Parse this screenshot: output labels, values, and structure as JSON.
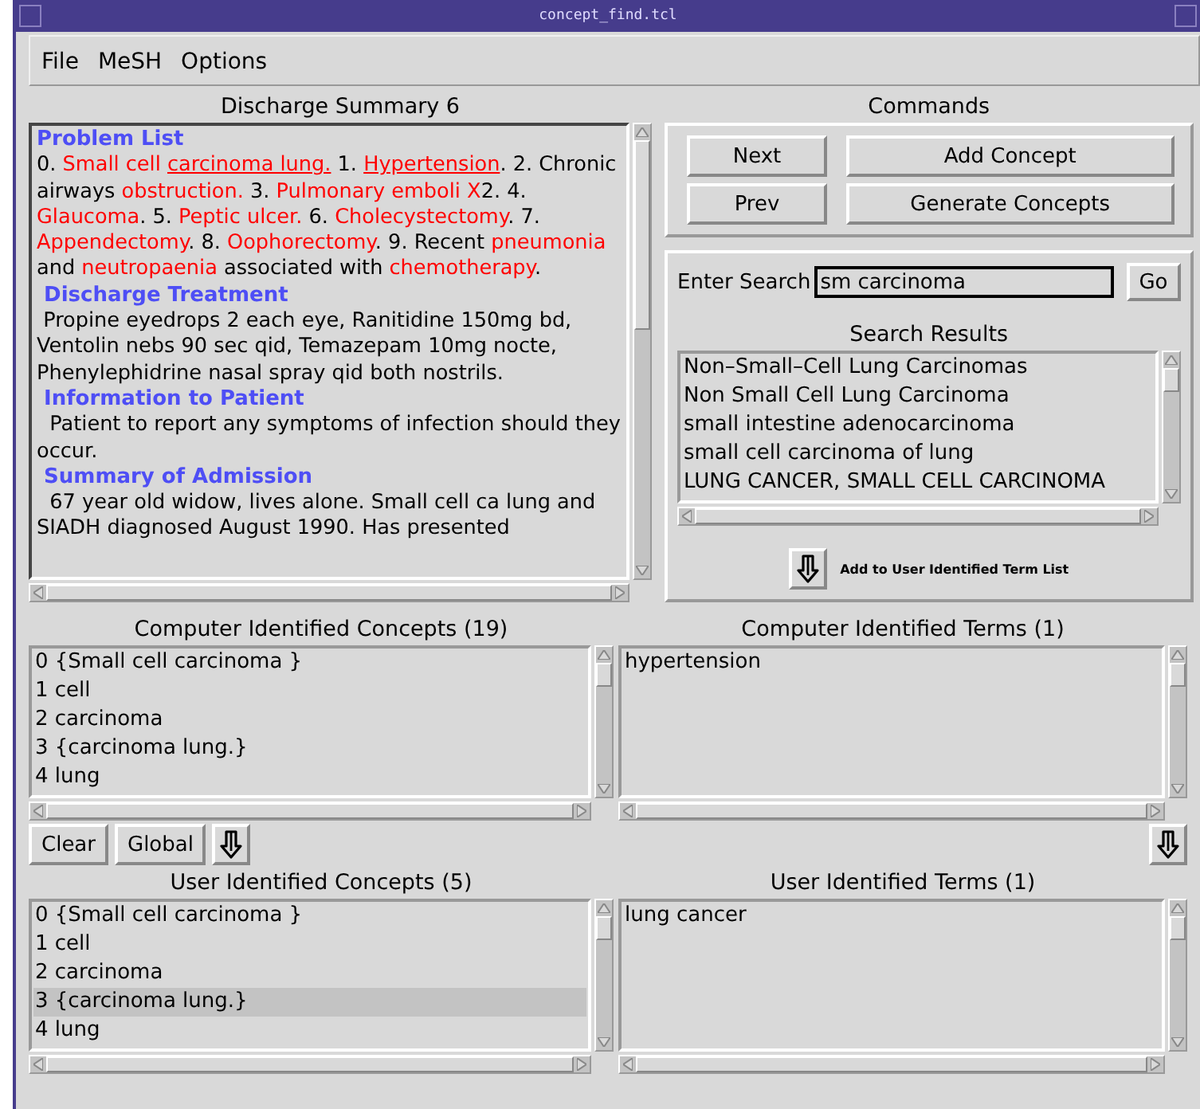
{
  "window": {
    "title": "concept_find.tcl"
  },
  "menu": [
    "File",
    "MeSH",
    "Options"
  ],
  "document": {
    "title": "Discharge Summary 6",
    "sections": [
      {
        "heading": "Problem List",
        "segments": [
          {
            "text": "0. ",
            "kind": "plain"
          },
          {
            "text": "Small cell ",
            "kind": "term"
          },
          {
            "text": "carcinoma lung.",
            "kind": "match"
          },
          {
            "text": " 1. ",
            "kind": "plain"
          },
          {
            "text": "Hypertension",
            "kind": "match"
          },
          {
            "text": ". 2. Chronic airways ",
            "kind": "plain"
          },
          {
            "text": "obstruction.",
            "kind": "term"
          },
          {
            "text": " 3. ",
            "kind": "plain"
          },
          {
            "text": "Pulmonary emboli X",
            "kind": "term"
          },
          {
            "text": "2. 4. ",
            "kind": "plain"
          },
          {
            "text": "Glaucoma",
            "kind": "term"
          },
          {
            "text": ". 5. ",
            "kind": "plain"
          },
          {
            "text": "Peptic ulcer.",
            "kind": "term"
          },
          {
            "text": " 6. ",
            "kind": "plain"
          },
          {
            "text": "Cholecystectomy",
            "kind": "term"
          },
          {
            "text": ". 7. ",
            "kind": "plain"
          },
          {
            "text": "Appendectomy",
            "kind": "term"
          },
          {
            "text": ". 8. ",
            "kind": "plain"
          },
          {
            "text": "Oophorectomy",
            "kind": "term"
          },
          {
            "text": ". 9. Recent ",
            "kind": "plain"
          },
          {
            "text": "pneumonia",
            "kind": "term"
          },
          {
            "text": " and ",
            "kind": "plain"
          },
          {
            "text": "neutropaenia",
            "kind": "term"
          },
          {
            "text": " associated with ",
            "kind": "plain"
          },
          {
            "text": "chemotherapy",
            "kind": "term"
          },
          {
            "text": ".",
            "kind": "plain"
          }
        ]
      },
      {
        "heading": " Discharge Treatment",
        "segments": [
          {
            "text": " Propine eyedrops 2 each eye, Ranitidine 150mg bd, Ventolin nebs 90 sec qid, Temazepam 10mg nocte, Phenylephidrine nasal spray qid both nostrils.",
            "kind": "plain"
          }
        ]
      },
      {
        "heading": " Information to Patient",
        "segments": [
          {
            "text": "  Patient to report any symptoms of infection should they occur.",
            "kind": "plain"
          }
        ]
      },
      {
        "heading": " Summary of Admission",
        "segments": [
          {
            "text": "  67 year old widow, lives alone. Small cell ca lung and SIADH diagnosed August 1990. Has presented",
            "kind": "plain"
          }
        ]
      }
    ]
  },
  "commands": {
    "title": "Commands",
    "buttons": [
      "Next",
      "Add Concept",
      "Prev",
      "Generate Concepts"
    ]
  },
  "search": {
    "label": "Enter Search",
    "value": "sm carcinoma",
    "go": "Go",
    "results_title": "Search Results",
    "results": [
      {
        "text": "Non–Small–Cell Lung Carcinomas",
        "selected": false
      },
      {
        "text": "Non Small Cell Lung Carcinoma",
        "selected": false
      },
      {
        "text": "small intestine adenocarcinoma",
        "selected": false
      },
      {
        "text": "small cell carcinoma of lung",
        "selected": false
      },
      {
        "text": "LUNG CANCER, SMALL CELL CARCINOMA",
        "selected": false
      }
    ],
    "add_label": "Add to User Identified Term List"
  },
  "computer_concepts": {
    "title": "Computer Identified Concepts (19)",
    "items": [
      {
        "text": "0 {Small cell carcinoma }",
        "selected": false
      },
      {
        "text": "1 cell",
        "selected": false
      },
      {
        "text": "2 carcinoma",
        "selected": false
      },
      {
        "text": "3 {carcinoma lung.}",
        "selected": false
      },
      {
        "text": "4 lung",
        "selected": false
      }
    ]
  },
  "computer_terms": {
    "title": "Computer Identified Terms (1)",
    "items": [
      {
        "text": "hypertension",
        "selected": false
      }
    ]
  },
  "actions": [
    "Clear",
    "Global"
  ],
  "user_concepts": {
    "title": "User Identified Concepts (5)",
    "items": [
      {
        "text": "0 {Small cell carcinoma }",
        "selected": false
      },
      {
        "text": "1 cell",
        "selected": false
      },
      {
        "text": "2 carcinoma",
        "selected": false
      },
      {
        "text": "3 {carcinoma lung.}",
        "selected": true
      },
      {
        "text": "4 lung",
        "selected": false
      }
    ]
  },
  "user_terms": {
    "title": "User Identified Terms (1)",
    "items": [
      {
        "text": "lung cancer",
        "selected": false
      }
    ]
  }
}
